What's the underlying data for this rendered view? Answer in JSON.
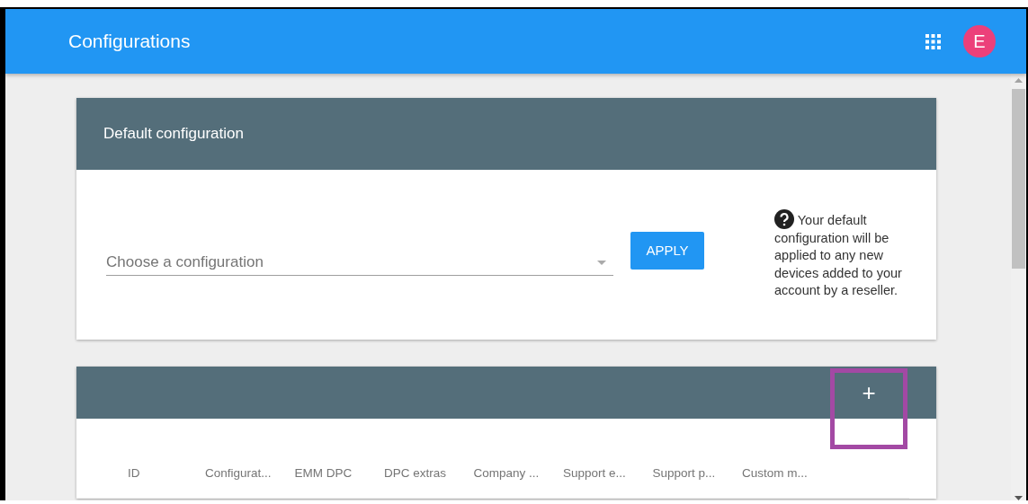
{
  "app_bar": {
    "title": "Configurations",
    "avatar_letter": "E"
  },
  "default_card": {
    "title": "Default configuration",
    "select": {
      "placeholder": "Choose a configuration"
    },
    "apply_button": "APPLY",
    "help_text": "Your default configuration will be applied to any new devices added to your account by a reseller."
  },
  "configs_card": {
    "add_button": "+",
    "add_highlighted": true,
    "table": {
      "columns": [
        "ID",
        "Configurat...",
        "EMM DPC",
        "DPC extras",
        "Company ...",
        "Support e...",
        "Support p...",
        "Custom m..."
      ]
    }
  }
}
